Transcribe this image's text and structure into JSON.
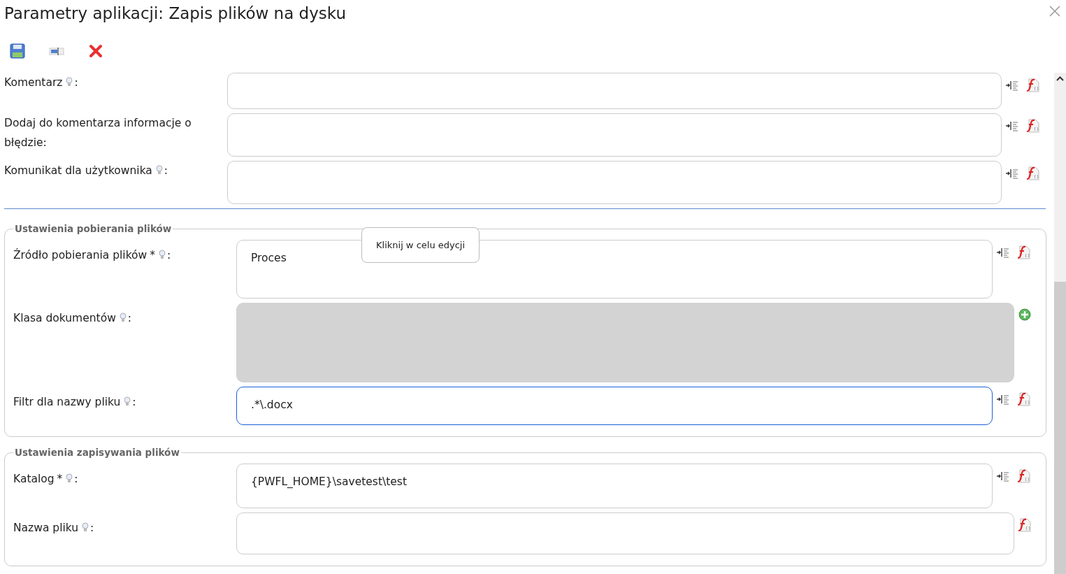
{
  "window": {
    "title": "Parametry aplikacji: Zapis plików na dysku"
  },
  "toolbar": [
    {
      "kind": "save"
    },
    {
      "kind": "field"
    },
    {
      "kind": "cancel"
    }
  ],
  "fields": [
    {
      "label": "Komentarz",
      "hint": true,
      "colon": ":",
      "kind": "text",
      "actions": [
        {
          "kind": "insert"
        },
        {
          "kind": "function"
        }
      ]
    },
    {
      "label": "Dodaj do komentarza informacje o błędzie:",
      "hint": false,
      "kind": "text",
      "actions": [
        {
          "kind": "insert"
        },
        {
          "kind": "function"
        }
      ]
    },
    {
      "label": "Komunikat dla użytkownika",
      "hint": true,
      "colon": ":",
      "kind": "text",
      "actions": [
        {
          "kind": "insert"
        },
        {
          "kind": "function"
        }
      ]
    }
  ],
  "sections": [
    {
      "legend": "Ustawienia pobierania plików",
      "tooltip": {
        "text": "Kliknij w celu edycji"
      },
      "fields": [
        {
          "label": "Źródło pobierania plików",
          "mark": "*",
          "hint": true,
          "colon": ":",
          "kind": "text",
          "value": "Proces",
          "actions": [
            {
              "kind": "insert"
            },
            {
              "kind": "function"
            }
          ]
        },
        {
          "label": "Klasa dokumentów",
          "hint": true,
          "colon": ":",
          "kind": "list",
          "disabled": true,
          "actions": [
            {
              "kind": "add"
            }
          ]
        },
        {
          "label": "Filtr dla nazwy pliku",
          "hint": true,
          "colon": ":",
          "kind": "text",
          "value": ".*\\.docx",
          "focused": true,
          "actions": [
            {
              "kind": "insert"
            },
            {
              "kind": "function"
            }
          ]
        }
      ]
    },
    {
      "legend": "Ustawienia zapisywania plików",
      "fields": [
        {
          "label": "Katalog",
          "mark": "*",
          "hint": true,
          "colon": ":",
          "kind": "text",
          "value": "{PWFL_HOME}\\savetest\\test",
          "actions": [
            {
              "kind": "insert"
            },
            {
              "kind": "function"
            }
          ]
        },
        {
          "label": "Nazwa pliku",
          "hint": true,
          "colon": ":",
          "kind": "text",
          "actions": [
            {
              "kind": "function"
            }
          ]
        }
      ]
    }
  ]
}
